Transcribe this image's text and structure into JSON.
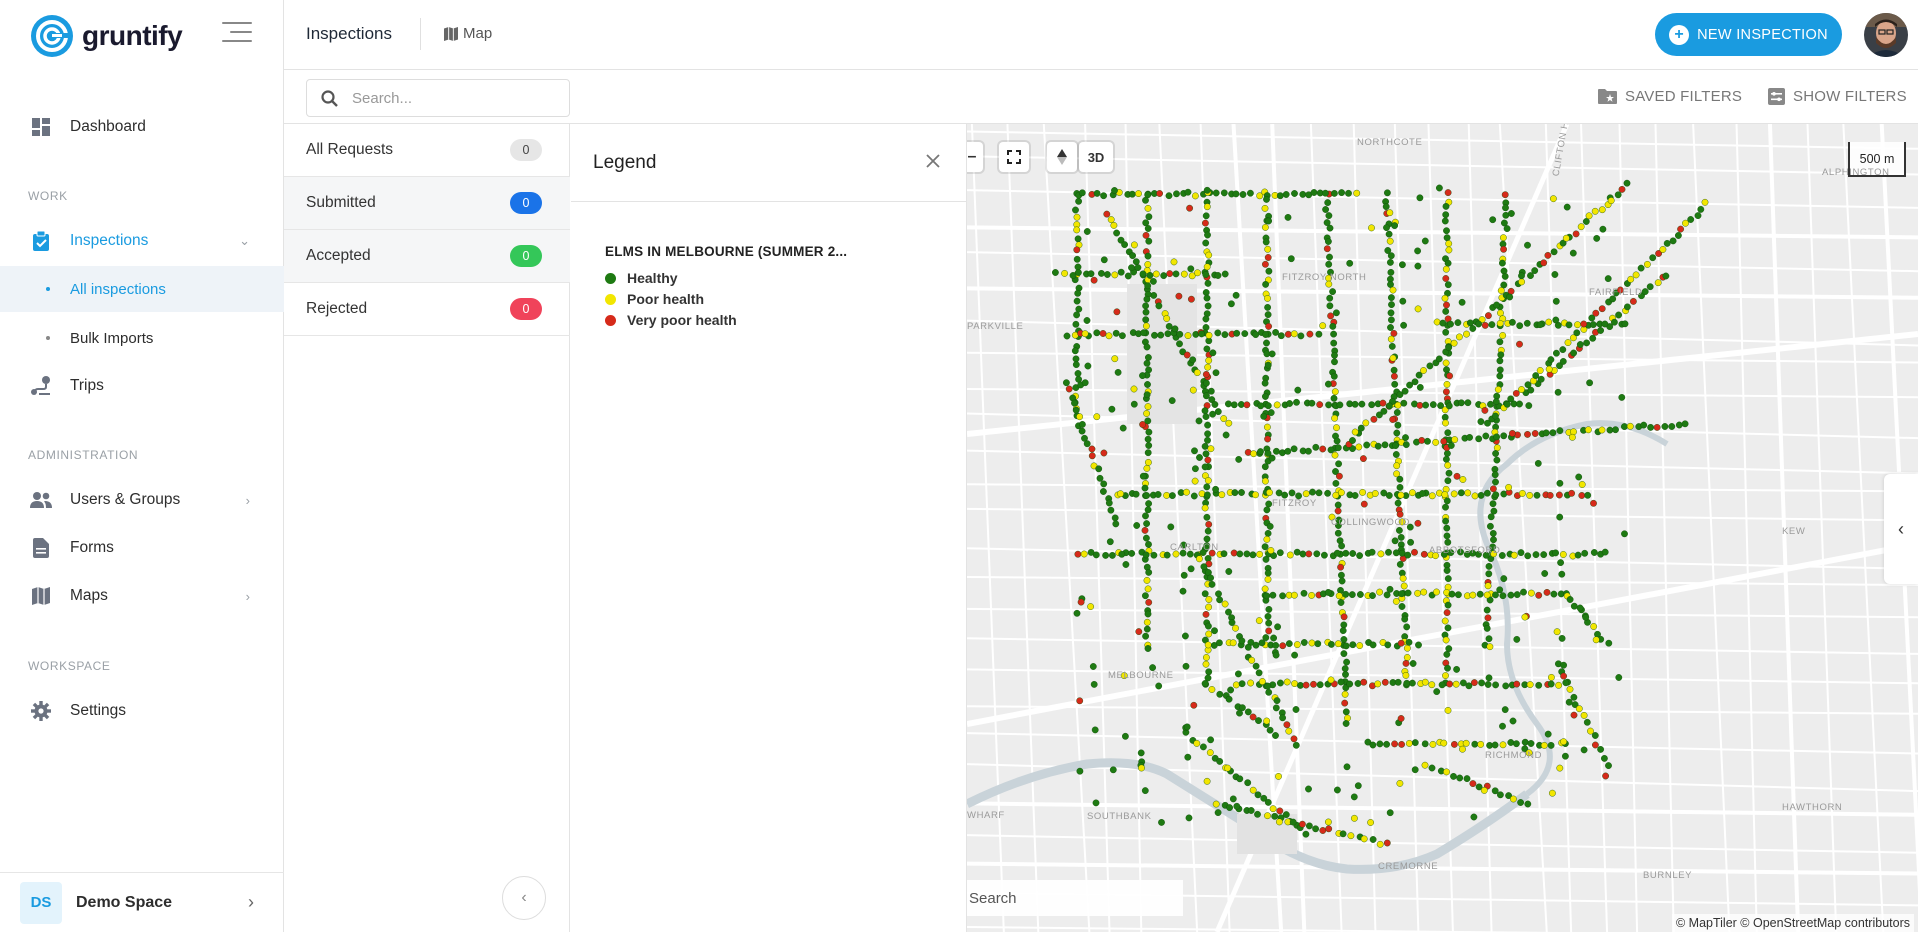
{
  "app": {
    "name": "gruntify"
  },
  "sidebar": {
    "dashboard": "Dashboard",
    "section_work": "WORK",
    "inspections": "Inspections",
    "all_inspections": "All inspections",
    "bulk_imports": "Bulk Imports",
    "trips": "Trips",
    "section_admin": "ADMINISTRATION",
    "users_groups": "Users & Groups",
    "forms": "Forms",
    "maps": "Maps",
    "section_workspace": "WORKSPACE",
    "settings": "Settings",
    "workspace_initials": "DS",
    "workspace_name": "Demo Space"
  },
  "header": {
    "title": "Inspections",
    "map_tab": "Map",
    "new_button": "NEW INSPECTION"
  },
  "toolbar": {
    "search_placeholder": "Search...",
    "saved_filters": "SAVED FILTERS",
    "show_filters": "SHOW FILTERS"
  },
  "statuses": [
    {
      "label": "All Requests",
      "count": "0",
      "color": "#e6e6e6",
      "text_color": "#444"
    },
    {
      "label": "Submitted",
      "count": "0",
      "color": "#1a73e8",
      "text_color": "#fff"
    },
    {
      "label": "Accepted",
      "count": "0",
      "color": "#34c759",
      "text_color": "#fff"
    },
    {
      "label": "Rejected",
      "count": "0",
      "color": "#f0435a",
      "text_color": "#fff"
    }
  ],
  "legend": {
    "title": "Legend",
    "layer_name": "ELMS IN MELBOURNE (SUMMER 2...",
    "items": [
      {
        "label": "Healthy",
        "color": "#1e7a12"
      },
      {
        "label": "Poor health",
        "color": "#f2e600"
      },
      {
        "label": "Very poor health",
        "color": "#d62a1a"
      }
    ]
  },
  "map": {
    "button_3d": "3D",
    "scale": "500 m",
    "search_placeholder": "Search",
    "attribution": "© MapTiler © OpenStreetMap contributors",
    "labels": [
      "NORTHCOTE",
      "CLIFTON HILL",
      "ALPHINGTON",
      "FAIRFIELD",
      "PARKVILLE",
      "FITZROY NORTH",
      "CARLTON",
      "FITZROY",
      "COLLINGWOOD",
      "ABBOTSFORD",
      "KEW",
      "MELBOURNE",
      "RICHMOND",
      "HAWTHORN",
      "SOUTHBANK",
      "CREMORNE",
      "BURNLEY",
      "WHARF"
    ]
  }
}
